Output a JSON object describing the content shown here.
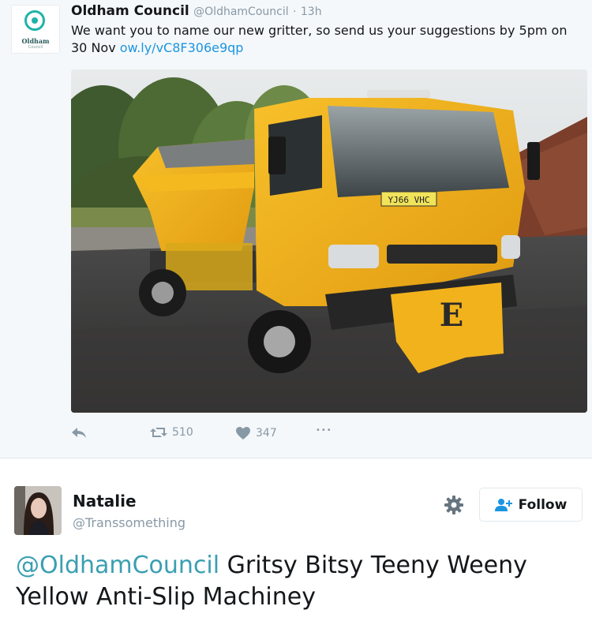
{
  "tweet1": {
    "avatar": {
      "logo_text": "Oldham",
      "logo_sub": "Council"
    },
    "author_name": "Oldham Council",
    "handle": "@OldhamCouncil",
    "separator": "·",
    "time": "13h",
    "text": "We want you to name our new gritter, so send us your suggestions by 5pm on 30 Nov",
    "link": "ow.ly/vC8F306e9qp",
    "photo": {
      "plate": "YJ66 VHC",
      "plow_letter": "E"
    },
    "actions": {
      "reply_icon": "reply-icon",
      "retweet_icon": "retweet-icon",
      "retweet_count": "510",
      "like_icon": "heart-icon",
      "like_count": "347",
      "more_icon": "more-dots-icon",
      "more_label": "•••"
    }
  },
  "tweet2": {
    "author_name": "Natalie",
    "handle": "@Transsomething",
    "gear_icon": "gear-icon",
    "follow_label": "Follow",
    "mention": "@OldhamCouncil",
    "text": " Gritsy Bitsy Teeny Weeny Yellow Anti-Slip Machiney"
  },
  "colors": {
    "link": "#1b95e0",
    "mention": "#3a9fb2",
    "muted": "#8899a6",
    "truck_yellow": "#f2b21c"
  }
}
